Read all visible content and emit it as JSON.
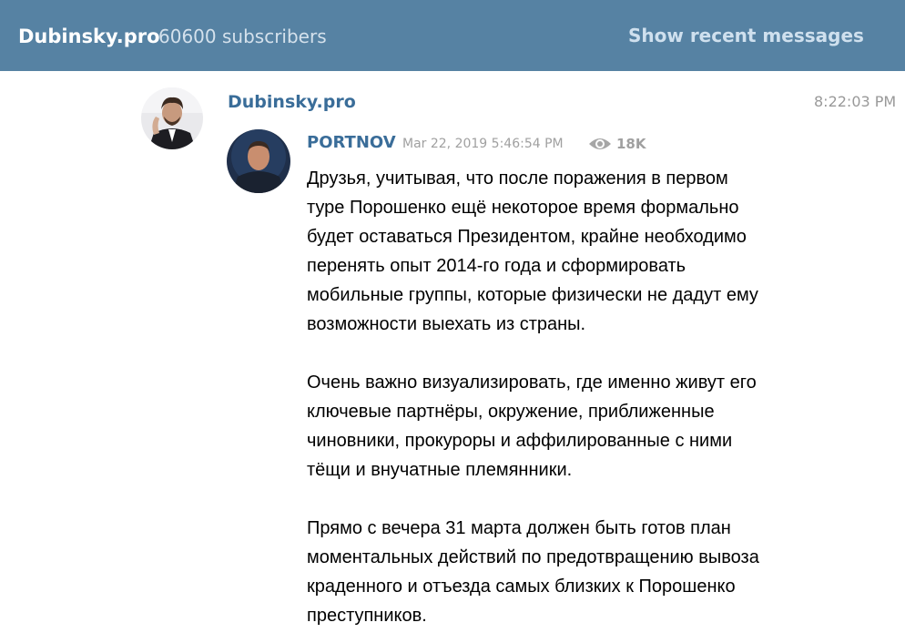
{
  "header": {
    "channel_title": "Dubinsky.pro",
    "subscribers": "60600 subscribers",
    "recent_button": "Show recent messages",
    "background_color": "#5682a3"
  },
  "message": {
    "author": "Dubinsky.pro",
    "time": "8:22:03 PM",
    "avatar_icon": "author-avatar",
    "forwarded": {
      "author": "PORTNOV",
      "date": "Mar 22, 2019 5:46:54 PM",
      "views": "18K",
      "views_icon": "eye-icon",
      "avatar_icon": "forwarded-author-avatar"
    },
    "paragraphs": [
      {
        "lines": [
          "Друзья, учитывая, что после поражения в первом",
          "туре Порошенко ещё некоторое время формально",
          "будет оставаться Президентом, крайне необходимо",
          "перенять опыт 2014-го года и сформировать",
          "мобильные группы, которые физически не дадут ему",
          "возможности выехать из страны."
        ]
      },
      {
        "lines": [
          "Очень важно визуализировать, где именно живут его",
          "ключевые партнёры, окружение, приближенные",
          "чиновники, прокуроры и аффилированные с ними",
          "тёщи и внучатные племянники."
        ]
      },
      {
        "lines": [
          "Прямо с вечера 31 марта должен быть готов план",
          "моментальных действий по предотвращению вывоза",
          "краденного и отъезда самых близких к Порошенко",
          "преступников."
        ]
      }
    ]
  }
}
